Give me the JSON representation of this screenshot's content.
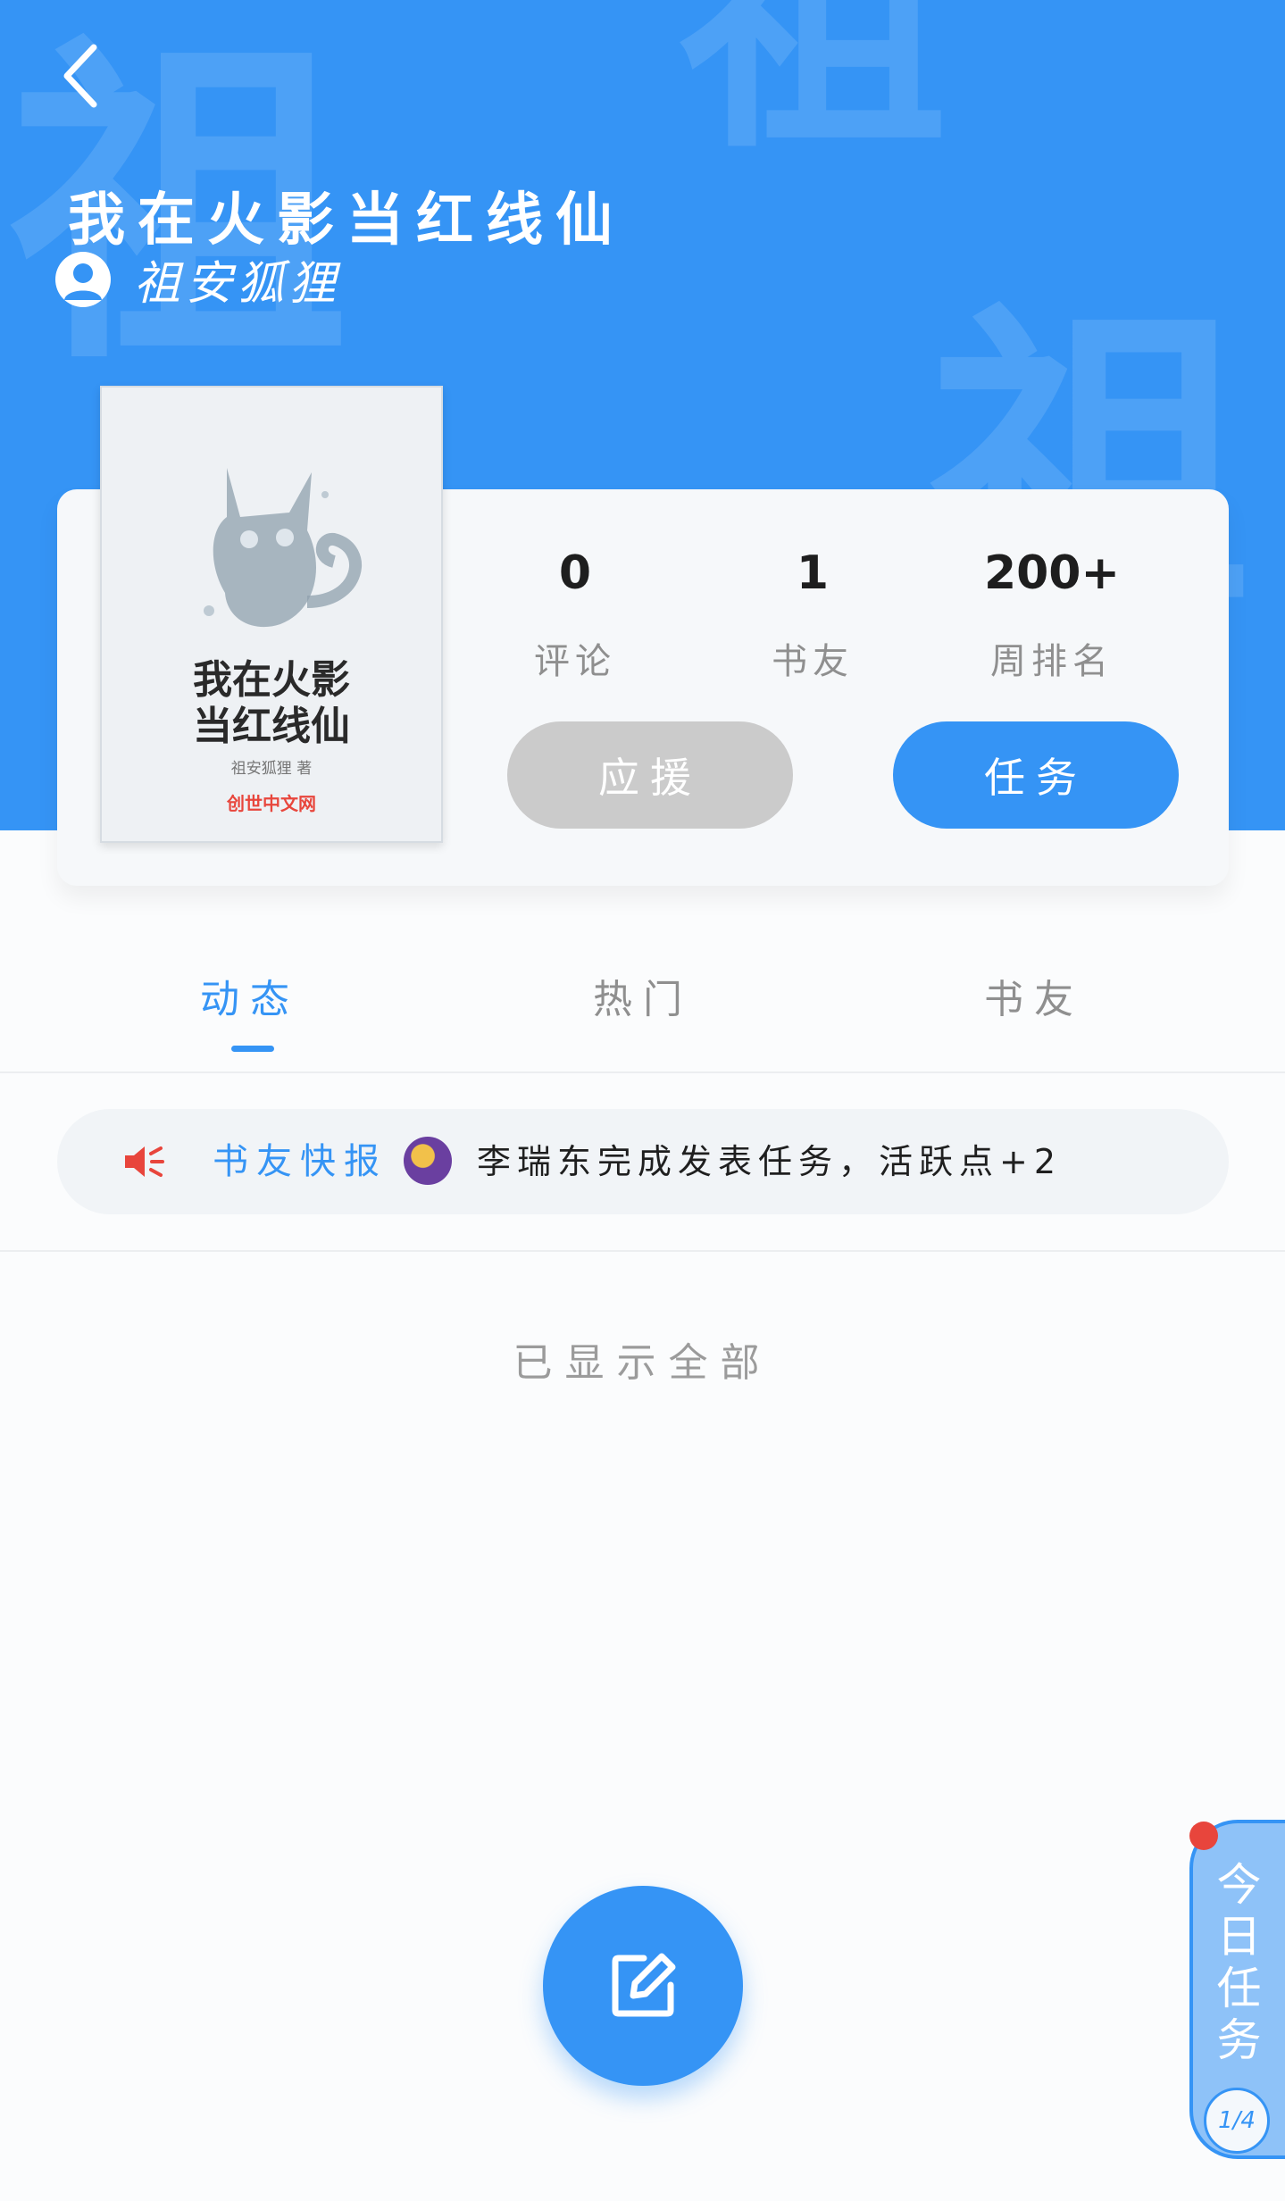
{
  "header": {
    "title": "我在火影当红线仙",
    "author": "祖安狐狸",
    "watermark": [
      "祖",
      "祖",
      "祖"
    ]
  },
  "book_cover": {
    "title_line1": "我在火影",
    "title_line2": "当红线仙",
    "author_line": "祖安狐狸 著",
    "publisher": "创世中文网"
  },
  "stats": [
    {
      "value": "0",
      "label": "评论"
    },
    {
      "value": "1",
      "label": "书友"
    },
    {
      "value": "200+",
      "label": "周排名"
    }
  ],
  "buttons": {
    "support": "应援",
    "task": "任务"
  },
  "tabs": [
    {
      "label": "动态",
      "active": true
    },
    {
      "label": "热门",
      "active": false
    },
    {
      "label": "书友",
      "active": false
    }
  ],
  "news": {
    "title": "书友快报",
    "text": "李瑞东完成发表任务，活跃点+2"
  },
  "end_text": "已显示全部",
  "daily_task": {
    "label": "今日任务",
    "progress": "1/4"
  },
  "colors": {
    "primary": "#3594f5",
    "disabled_button": "#cbcbcb",
    "speaker_red": "#e8453c",
    "background": "#fbfcfd"
  },
  "icons": [
    "back-arrow-icon",
    "user-avatar-icon",
    "speaker-icon",
    "edit-icon"
  ]
}
